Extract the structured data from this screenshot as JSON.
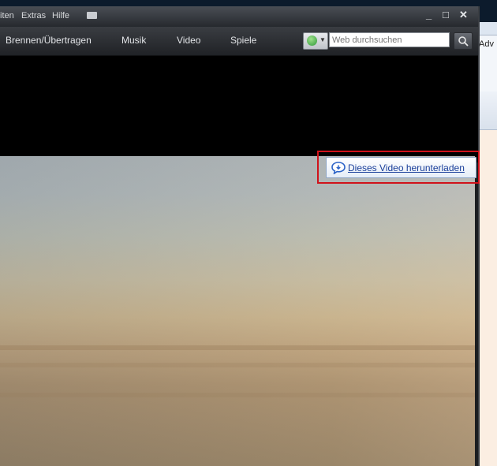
{
  "background_app": {
    "label": "Adv"
  },
  "menubar": {
    "items": [
      "iten",
      "Extras",
      "Hilfe"
    ]
  },
  "window_controls": {
    "minimize": "_",
    "maximize": "□",
    "close": "✕"
  },
  "nav": {
    "items": [
      "Brennen/Übertragen",
      "Musik",
      "Video",
      "Spiele"
    ]
  },
  "search": {
    "placeholder": "Web durchsuchen"
  },
  "video_overlay": {
    "download_label": "Dieses Video herunterladen"
  },
  "colors": {
    "highlight": "#d0121a",
    "link": "#1a3f9a"
  }
}
